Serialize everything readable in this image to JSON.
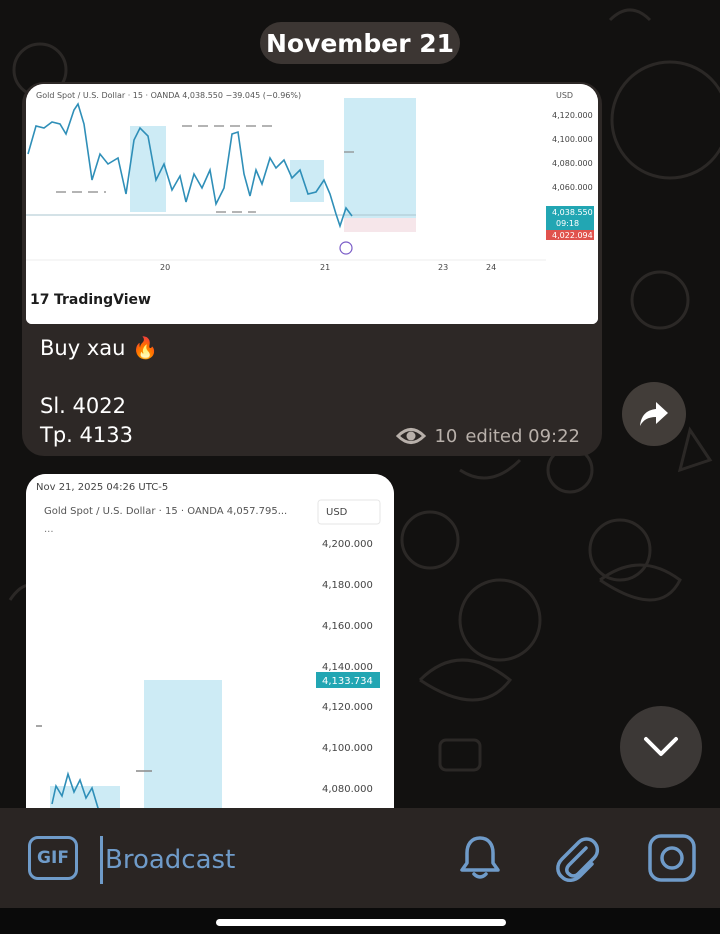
{
  "date_divider": "November 21",
  "message1": {
    "chart_header": "Gold Spot / U.S. Dollar · 15 · OANDA 4,038.550 −39.045 (−0.96%)",
    "chart_currency": "USD",
    "price_ticks": [
      "4,120.000",
      "4,100.000",
      "4,080.000",
      "4,060.000"
    ],
    "current_price": "4,038.550",
    "countdown": "09:18",
    "stop_price": "4,022.094",
    "date_ticks": [
      "20",
      "21",
      "23",
      "24"
    ],
    "brand": "TradingView",
    "caption": "Buy xau 🔥\n\nSl. 4022\nTp. 4133",
    "views": "10",
    "edited": "edited 09:22"
  },
  "message2": {
    "timestamp": "Nov 21, 2025 04:26 UTC-5",
    "chart_header": "Gold Spot / U.S. Dollar · 15 · OANDA  4,057.795...",
    "chart_currency": "USD",
    "price_ticks": [
      "4,200.000",
      "4,180.000",
      "4,160.000",
      "4,140.000",
      "4,120.000",
      "4,100.000",
      "4,080.000"
    ],
    "target_price": "4,133.734"
  },
  "input": {
    "gif_label": "GIF",
    "placeholder": "Broadcast"
  },
  "icons": {
    "share": "share-arrow-icon",
    "scroll_down": "chevron-down-icon",
    "bell": "bell-icon",
    "attach": "paperclip-icon",
    "camera": "instagram-camera-icon",
    "views": "eye-icon"
  },
  "colors": {
    "accent": "#6f9bc9",
    "chart_line": "#2f8fb8",
    "target_zone": "#cdebf5",
    "price_label": "#22a6b3",
    "stop_label": "#e0524d"
  }
}
